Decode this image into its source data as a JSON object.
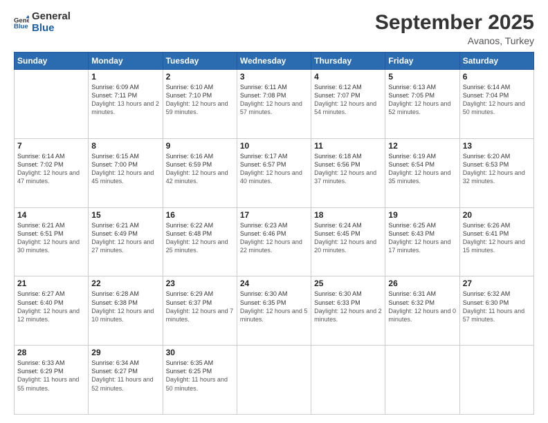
{
  "header": {
    "logo_general": "General",
    "logo_blue": "Blue",
    "month_title": "September 2025",
    "subtitle": "Avanos, Turkey"
  },
  "days_of_week": [
    "Sunday",
    "Monday",
    "Tuesday",
    "Wednesday",
    "Thursday",
    "Friday",
    "Saturday"
  ],
  "weeks": [
    [
      {
        "day": "",
        "sunrise": "",
        "sunset": "",
        "daylight": ""
      },
      {
        "day": "1",
        "sunrise": "Sunrise: 6:09 AM",
        "sunset": "Sunset: 7:11 PM",
        "daylight": "Daylight: 13 hours and 2 minutes."
      },
      {
        "day": "2",
        "sunrise": "Sunrise: 6:10 AM",
        "sunset": "Sunset: 7:10 PM",
        "daylight": "Daylight: 12 hours and 59 minutes."
      },
      {
        "day": "3",
        "sunrise": "Sunrise: 6:11 AM",
        "sunset": "Sunset: 7:08 PM",
        "daylight": "Daylight: 12 hours and 57 minutes."
      },
      {
        "day": "4",
        "sunrise": "Sunrise: 6:12 AM",
        "sunset": "Sunset: 7:07 PM",
        "daylight": "Daylight: 12 hours and 54 minutes."
      },
      {
        "day": "5",
        "sunrise": "Sunrise: 6:13 AM",
        "sunset": "Sunset: 7:05 PM",
        "daylight": "Daylight: 12 hours and 52 minutes."
      },
      {
        "day": "6",
        "sunrise": "Sunrise: 6:14 AM",
        "sunset": "Sunset: 7:04 PM",
        "daylight": "Daylight: 12 hours and 50 minutes."
      }
    ],
    [
      {
        "day": "7",
        "sunrise": "Sunrise: 6:14 AM",
        "sunset": "Sunset: 7:02 PM",
        "daylight": "Daylight: 12 hours and 47 minutes."
      },
      {
        "day": "8",
        "sunrise": "Sunrise: 6:15 AM",
        "sunset": "Sunset: 7:00 PM",
        "daylight": "Daylight: 12 hours and 45 minutes."
      },
      {
        "day": "9",
        "sunrise": "Sunrise: 6:16 AM",
        "sunset": "Sunset: 6:59 PM",
        "daylight": "Daylight: 12 hours and 42 minutes."
      },
      {
        "day": "10",
        "sunrise": "Sunrise: 6:17 AM",
        "sunset": "Sunset: 6:57 PM",
        "daylight": "Daylight: 12 hours and 40 minutes."
      },
      {
        "day": "11",
        "sunrise": "Sunrise: 6:18 AM",
        "sunset": "Sunset: 6:56 PM",
        "daylight": "Daylight: 12 hours and 37 minutes."
      },
      {
        "day": "12",
        "sunrise": "Sunrise: 6:19 AM",
        "sunset": "Sunset: 6:54 PM",
        "daylight": "Daylight: 12 hours and 35 minutes."
      },
      {
        "day": "13",
        "sunrise": "Sunrise: 6:20 AM",
        "sunset": "Sunset: 6:53 PM",
        "daylight": "Daylight: 12 hours and 32 minutes."
      }
    ],
    [
      {
        "day": "14",
        "sunrise": "Sunrise: 6:21 AM",
        "sunset": "Sunset: 6:51 PM",
        "daylight": "Daylight: 12 hours and 30 minutes."
      },
      {
        "day": "15",
        "sunrise": "Sunrise: 6:21 AM",
        "sunset": "Sunset: 6:49 PM",
        "daylight": "Daylight: 12 hours and 27 minutes."
      },
      {
        "day": "16",
        "sunrise": "Sunrise: 6:22 AM",
        "sunset": "Sunset: 6:48 PM",
        "daylight": "Daylight: 12 hours and 25 minutes."
      },
      {
        "day": "17",
        "sunrise": "Sunrise: 6:23 AM",
        "sunset": "Sunset: 6:46 PM",
        "daylight": "Daylight: 12 hours and 22 minutes."
      },
      {
        "day": "18",
        "sunrise": "Sunrise: 6:24 AM",
        "sunset": "Sunset: 6:45 PM",
        "daylight": "Daylight: 12 hours and 20 minutes."
      },
      {
        "day": "19",
        "sunrise": "Sunrise: 6:25 AM",
        "sunset": "Sunset: 6:43 PM",
        "daylight": "Daylight: 12 hours and 17 minutes."
      },
      {
        "day": "20",
        "sunrise": "Sunrise: 6:26 AM",
        "sunset": "Sunset: 6:41 PM",
        "daylight": "Daylight: 12 hours and 15 minutes."
      }
    ],
    [
      {
        "day": "21",
        "sunrise": "Sunrise: 6:27 AM",
        "sunset": "Sunset: 6:40 PM",
        "daylight": "Daylight: 12 hours and 12 minutes."
      },
      {
        "day": "22",
        "sunrise": "Sunrise: 6:28 AM",
        "sunset": "Sunset: 6:38 PM",
        "daylight": "Daylight: 12 hours and 10 minutes."
      },
      {
        "day": "23",
        "sunrise": "Sunrise: 6:29 AM",
        "sunset": "Sunset: 6:37 PM",
        "daylight": "Daylight: 12 hours and 7 minutes."
      },
      {
        "day": "24",
        "sunrise": "Sunrise: 6:30 AM",
        "sunset": "Sunset: 6:35 PM",
        "daylight": "Daylight: 12 hours and 5 minutes."
      },
      {
        "day": "25",
        "sunrise": "Sunrise: 6:30 AM",
        "sunset": "Sunset: 6:33 PM",
        "daylight": "Daylight: 12 hours and 2 minutes."
      },
      {
        "day": "26",
        "sunrise": "Sunrise: 6:31 AM",
        "sunset": "Sunset: 6:32 PM",
        "daylight": "Daylight: 12 hours and 0 minutes."
      },
      {
        "day": "27",
        "sunrise": "Sunrise: 6:32 AM",
        "sunset": "Sunset: 6:30 PM",
        "daylight": "Daylight: 11 hours and 57 minutes."
      }
    ],
    [
      {
        "day": "28",
        "sunrise": "Sunrise: 6:33 AM",
        "sunset": "Sunset: 6:29 PM",
        "daylight": "Daylight: 11 hours and 55 minutes."
      },
      {
        "day": "29",
        "sunrise": "Sunrise: 6:34 AM",
        "sunset": "Sunset: 6:27 PM",
        "daylight": "Daylight: 11 hours and 52 minutes."
      },
      {
        "day": "30",
        "sunrise": "Sunrise: 6:35 AM",
        "sunset": "Sunset: 6:25 PM",
        "daylight": "Daylight: 11 hours and 50 minutes."
      },
      {
        "day": "",
        "sunrise": "",
        "sunset": "",
        "daylight": ""
      },
      {
        "day": "",
        "sunrise": "",
        "sunset": "",
        "daylight": ""
      },
      {
        "day": "",
        "sunrise": "",
        "sunset": "",
        "daylight": ""
      },
      {
        "day": "",
        "sunrise": "",
        "sunset": "",
        "daylight": ""
      }
    ]
  ]
}
